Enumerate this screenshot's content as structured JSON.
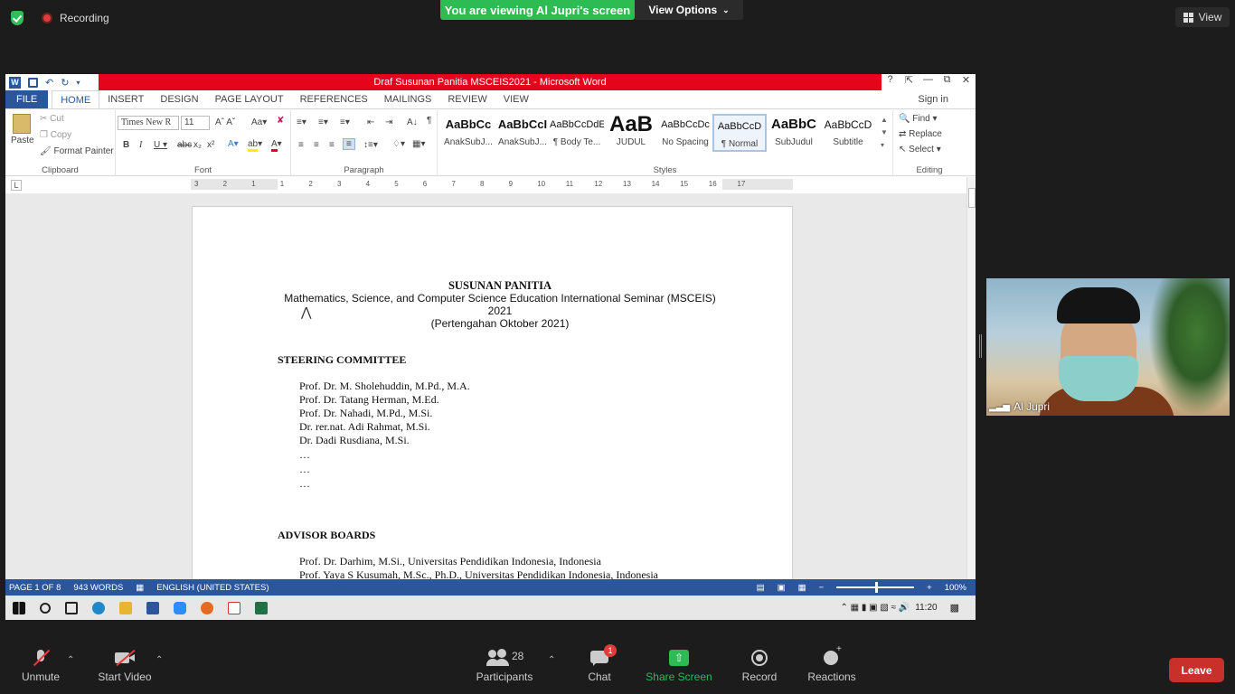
{
  "zoom": {
    "recording_label": "Recording",
    "viewing_banner": "You are viewing Al Jupri's screen",
    "view_options": "View Options",
    "view_button": "View",
    "participant_name": "Al Jupri",
    "toolbar": {
      "unmute": "Unmute",
      "start_video": "Start Video",
      "participants": "Participants",
      "participants_count": "28",
      "chat": "Chat",
      "chat_badge": "1",
      "share_screen": "Share Screen",
      "record": "Record",
      "reactions": "Reactions",
      "leave": "Leave"
    },
    "accent_green": "#2dbb53",
    "leave_red": "#c9302c"
  },
  "word": {
    "title": "Draf Susunan Panitia MSCEIS2021 -  Microsoft Word",
    "sign_in": "Sign in",
    "tabs": [
      "FILE",
      "HOME",
      "INSERT",
      "DESIGN",
      "PAGE LAYOUT",
      "REFERENCES",
      "MAILINGS",
      "REVIEW",
      "VIEW"
    ],
    "clipboard": {
      "paste": "Paste",
      "cut": "Cut",
      "copy": "Copy",
      "format_painter": "Format Painter",
      "label": "Clipboard"
    },
    "font": {
      "name": "Times New R",
      "size": "11",
      "label": "Font"
    },
    "paragraph": {
      "label": "Paragraph"
    },
    "styles": {
      "label": "Styles",
      "items": [
        {
          "preview": "AaBbCc",
          "name": "AnakSubJ..."
        },
        {
          "preview": "AaBbCcI",
          "name": "AnakSubJ..."
        },
        {
          "preview": "AaBbCcDdE",
          "name": "¶ Body Te..."
        },
        {
          "preview": "AaB",
          "name": "JUDUL"
        },
        {
          "preview": "AaBbCcDc",
          "name": "No Spacing"
        },
        {
          "preview": "AaBbCcD",
          "name": "¶ Normal"
        },
        {
          "preview": "AaBbC",
          "name": "SubJudul"
        },
        {
          "preview": "AaBbCcD",
          "name": "Subtitle"
        }
      ]
    },
    "editing": {
      "find": "Find",
      "replace": "Replace",
      "select": "Select",
      "label": "Editing"
    },
    "ruler_numbers": [
      "3",
      "2",
      "1",
      "1",
      "2",
      "3",
      "4",
      "5",
      "6",
      "7",
      "8",
      "9",
      "10",
      "11",
      "12",
      "13",
      "14",
      "15",
      "16",
      "17"
    ],
    "document": {
      "heading": "SUSUNAN PANITIA",
      "subtitle1": "Mathematics, Science, and Computer Science Education International Seminar (MSCEIS)",
      "subtitle2": "2021",
      "subtitle3": "(Pertengahan Oktober 2021)",
      "steering_title": "STEERING COMMITTEE",
      "steering": [
        "Prof. Dr. M. Sholehuddin, M.Pd., M.A.",
        "Prof. Dr. Tatang Herman, M.Ed.",
        "Prof. Dr. Nahadi, M.Pd., M.Si.",
        "Dr. rer.nat. Adi Rahmat, M.Si.",
        "Dr. Dadi Rusdiana, M.Si.",
        "…",
        "…",
        "…"
      ],
      "advisor_title": "ADVISOR BOARDS",
      "advisors": [
        "Prof. Dr. Darhim, M.Si., Universitas Pendidikan Indonesia, Indonesia",
        "Prof. Yaya S Kusumah, M.Sc., Ph.D., Universitas Pendidikan Indonesia, Indonesia"
      ]
    },
    "status": {
      "page": "PAGE 1 OF 8",
      "words": "943 WORDS",
      "language": "ENGLISH (UNITED STATES)",
      "zoom": "100%"
    },
    "taskbar_time": "11:20",
    "title_red": "#e4051a",
    "brand_blue": "#2b579a"
  }
}
